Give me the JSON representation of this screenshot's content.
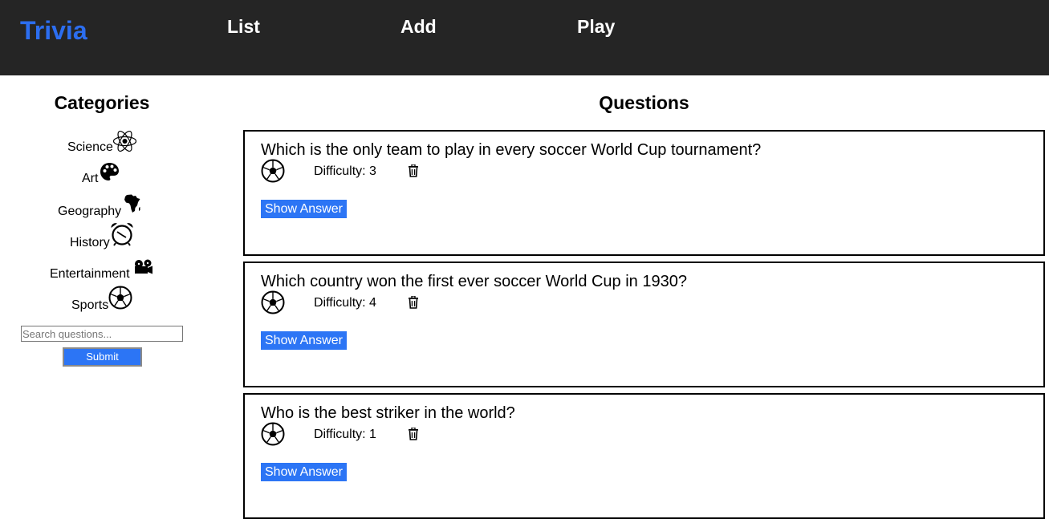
{
  "colors": {
    "header_bg": "#252525",
    "brand": "#2c6ef0",
    "accent_button": "#2c75f5"
  },
  "header": {
    "brand": "Trivia",
    "nav": [
      "List",
      "Add",
      "Play"
    ]
  },
  "sidebar": {
    "title": "Categories",
    "categories": [
      {
        "label": "Science",
        "icon": "atom-icon"
      },
      {
        "label": "Art",
        "icon": "palette-icon"
      },
      {
        "label": "Geography",
        "icon": "africa-map-icon"
      },
      {
        "label": "History",
        "icon": "alarm-clock-icon"
      },
      {
        "label": "Entertainment",
        "icon": "movie-camera-icon"
      },
      {
        "label": "Sports",
        "icon": "soccer-ball-icon"
      }
    ],
    "search": {
      "placeholder": "Search questions...",
      "value": ""
    },
    "submit_label": "Submit"
  },
  "main": {
    "title": "Questions",
    "difficulty_prefix": "Difficulty:",
    "show_answer_label": "Show Answer",
    "questions": [
      {
        "question": "Which is the only team to play in every soccer World Cup tournament?",
        "difficulty": "3",
        "difficulty_text": "Difficulty: 3",
        "category_icon": "soccer-ball-icon"
      },
      {
        "question": "Which country won the first ever soccer World Cup in 1930?",
        "difficulty": "4",
        "difficulty_text": "Difficulty: 4",
        "category_icon": "soccer-ball-icon"
      },
      {
        "question": "Who is the best striker in the world?",
        "difficulty": "1",
        "difficulty_text": "Difficulty: 1",
        "category_icon": "soccer-ball-icon"
      }
    ]
  }
}
